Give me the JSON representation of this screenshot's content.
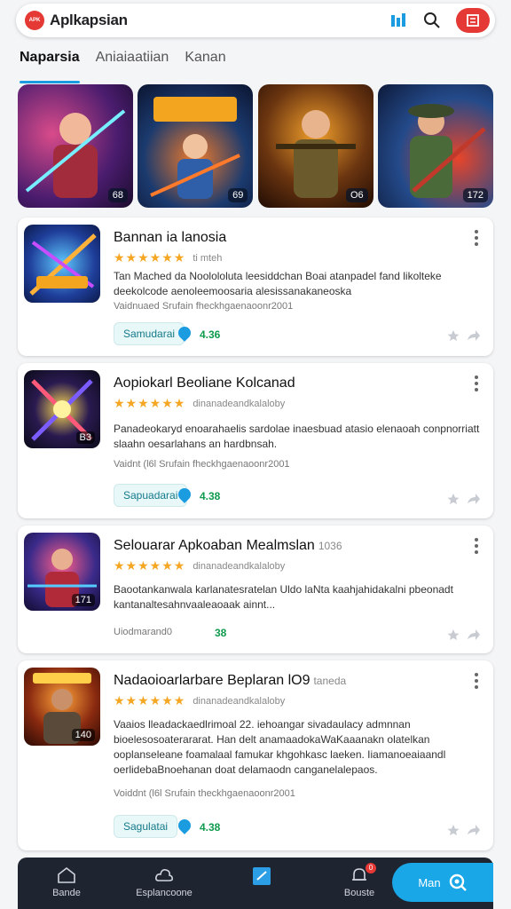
{
  "header": {
    "logo_text": "APK",
    "title": "Aplkapsian",
    "icons": [
      "grid-icon",
      "search-icon",
      "menu-icon"
    ]
  },
  "tabs": [
    {
      "label": "Naparsia",
      "active": true
    },
    {
      "label": "Aniaiaatiian",
      "active": false
    },
    {
      "label": "Kanan",
      "active": false
    }
  ],
  "banners": [
    {
      "badge": "68"
    },
    {
      "badge": "69"
    },
    {
      "badge": "O6"
    },
    {
      "badge": "172"
    }
  ],
  "cards": [
    {
      "title": "Bannan ia lanosia",
      "title_suffix": "",
      "thumb_num": "",
      "rating_tag": "ti mteh",
      "desc": "Tan Mached da Noolololuta leesiddchan Boai atanpadel fand likolteke deekolcode aenoleemoosaria alesissanakaneoska",
      "meta": "Vaidnuaed Srufain fheckhgaenaoonr2001",
      "chip": "Samudarai",
      "size": "4.36"
    },
    {
      "title": "Aopiokarl Beoliane Kolcanad",
      "title_suffix": "",
      "thumb_num": "B3",
      "rating_tag": "dinanadeandkalaloby",
      "desc": "Panadeokaryd enoarahaelis sardolae inaesbuad atasio elenaoah conpnorriatt slaahn oesarlahans an hardbnsah.",
      "meta": "Vaidnt (l6l Srufain fheckhgaenaoonr2001",
      "chip": "Sapuadarai",
      "size": "4.38"
    },
    {
      "title": "Selouarar Apkoaban Mealmslan",
      "title_suffix": "1036",
      "thumb_num": "171",
      "rating_tag": "dinanadeandkalaloby",
      "desc": "Baootankanwala karlanatesratelan Uldo laNta kaahjahidakalni pbeonadt kantanaltesahnvaaleaoaak ainnt...",
      "meta": "Uiodmarand0",
      "chip": "",
      "size": "38"
    },
    {
      "title": "Nadaoioarlarbare Beplaran lO9",
      "title_suffix": "taneda",
      "thumb_num": "140",
      "rating_tag": "dinanadeandkalaloby",
      "desc": "Vaaios lleadackaedlrimoal 22. iehoangar sivadaulacy admnnan bioelesosoaterararat. Han delt anamaadokaWaKaaanakn olatelkan ooplanseleane foamalaal famukar khgohkasc laeken. Iiamanoeaiaandl oerlidebaBnoehanan doat delamaodn canganelalepaos.",
      "meta": "Voiddnt (l6l Srufain theckhgaenaoonr2001",
      "chip": "Sagulatai",
      "size": "4.38"
    }
  ],
  "bottom_nav": [
    {
      "label": "Bande",
      "icon": "home-icon"
    },
    {
      "label": "Esplancoone",
      "icon": "cloud-icon"
    },
    {
      "label": "",
      "icon": "edit-square-icon"
    },
    {
      "label": "Bouste",
      "icon": "bell-icon",
      "badge": "0"
    }
  ],
  "bottom_cta": {
    "label": "Man",
    "icon": "search-icon"
  },
  "colors": {
    "accent": "#1b9be0",
    "brand_red": "#e53935",
    "nav_bg": "#1f2431",
    "star": "#f5a623",
    "size_green": "#0f9a4d"
  }
}
